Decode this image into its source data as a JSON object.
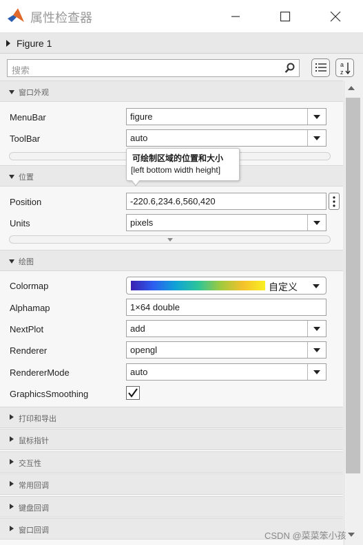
{
  "window": {
    "title": "属性检查器",
    "icon": "matlab-icon"
  },
  "figure_header": {
    "label": "Figure 1"
  },
  "search": {
    "placeholder": "搜索"
  },
  "sections": {
    "appearance": "窗口外观",
    "position": "位置",
    "plotting": "绘图",
    "printing": "打印和导出",
    "mouse_pointer": "鼠标指针",
    "interactivity": "交互性",
    "common_callbacks": "常用回调",
    "keyboard_callbacks": "键盘回调",
    "window_callbacks": "窗口回调"
  },
  "properties": {
    "menubar": {
      "label": "MenuBar",
      "value": "figure"
    },
    "toolbar": {
      "label": "ToolBar",
      "value": "auto"
    },
    "position": {
      "label": "Position",
      "value": "-220.6,234.6,560,420"
    },
    "units": {
      "label": "Units",
      "value": "pixels"
    },
    "colormap": {
      "label": "Colormap",
      "value": "自定义"
    },
    "alphamap": {
      "label": "Alphamap",
      "value": "1×64 double"
    },
    "nextplot": {
      "label": "NextPlot",
      "value": "add"
    },
    "renderer": {
      "label": "Renderer",
      "value": "opengl"
    },
    "renderermode": {
      "label": "RendererMode",
      "value": "auto"
    },
    "graphicssmoothing": {
      "label": "GraphicsSmoothing",
      "checked": true
    }
  },
  "tooltip": {
    "line1": "可绘制区域的位置和大小",
    "line2": "[left bottom width height]"
  },
  "watermark": "CSDN @菜菜笨小孩",
  "colors": {
    "colormap_start": "#3b1fb0",
    "colormap_end": "#f9f023"
  }
}
